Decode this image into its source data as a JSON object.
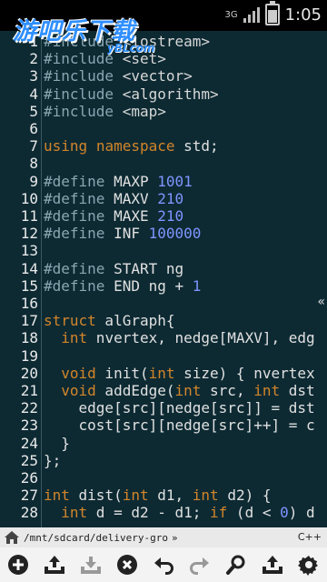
{
  "status_bar": {
    "network": "3G",
    "time": "1:05"
  },
  "watermark": {
    "title": "游吧乐下载",
    "subtitle": "yBLcom"
  },
  "code_lines": [
    {
      "n": "1",
      "t": "#include <iostream>"
    },
    {
      "n": "2",
      "t": "#include <set>"
    },
    {
      "n": "3",
      "t": "#include <vector>"
    },
    {
      "n": "4",
      "t": "#include <algorithm>"
    },
    {
      "n": "5",
      "t": "#include <map>"
    },
    {
      "n": "6",
      "t": ""
    },
    {
      "n": "7",
      "t": "using namespace std;"
    },
    {
      "n": "8",
      "t": ""
    },
    {
      "n": "9",
      "t": "#define MAXP 1001"
    },
    {
      "n": "10",
      "t": "#define MAXV 210"
    },
    {
      "n": "11",
      "t": "#define MAXE 210"
    },
    {
      "n": "12",
      "t": "#define INF 100000"
    },
    {
      "n": "13",
      "t": ""
    },
    {
      "n": "14",
      "t": "#define START ng"
    },
    {
      "n": "15",
      "t": "#define END ng + 1"
    },
    {
      "n": "16",
      "t": ""
    },
    {
      "n": "17",
      "t": "struct alGraph{"
    },
    {
      "n": "18",
      "t": "  int nvertex, nedge[MAXV], edg"
    },
    {
      "n": "19",
      "t": ""
    },
    {
      "n": "20",
      "t": "  void init(int size) { nvertex"
    },
    {
      "n": "21",
      "t": "  void addEdge(int src, int dst"
    },
    {
      "n": "22",
      "t": "    edge[src][nedge[src]] = dst"
    },
    {
      "n": "23",
      "t": "    cost[src][nedge[src]++] = c"
    },
    {
      "n": "24",
      "t": "  }"
    },
    {
      "n": "25",
      "t": "};"
    },
    {
      "n": "26",
      "t": ""
    },
    {
      "n": "27",
      "t": "int dist(int d1, int d2) {"
    },
    {
      "n": "28",
      "t": "  int d = d2 - d1; if (d < 0) d"
    }
  ],
  "path_bar": {
    "path": "/mnt/sdcard/delivery-gro",
    "chevron": "»",
    "language": "C++"
  },
  "toolbar": [
    {
      "name": "add-icon"
    },
    {
      "name": "upload-icon"
    },
    {
      "name": "download-icon"
    },
    {
      "name": "close-icon"
    },
    {
      "name": "undo-icon"
    },
    {
      "name": "redo-icon"
    },
    {
      "name": "search-icon"
    },
    {
      "name": "export-icon"
    },
    {
      "name": "settings-icon"
    }
  ]
}
